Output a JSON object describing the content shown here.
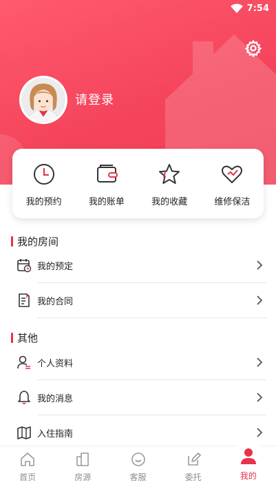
{
  "status_bar": {
    "time": "7:54"
  },
  "profile": {
    "login_text": "请登录"
  },
  "quick_actions": [
    {
      "label": "我的预约",
      "icon": "clock-icon"
    },
    {
      "label": "我的账单",
      "icon": "wallet-icon"
    },
    {
      "label": "我的收藏",
      "icon": "star-icon"
    },
    {
      "label": "维修保洁",
      "icon": "heart-icon"
    }
  ],
  "sections": [
    {
      "title": "我的房间",
      "items": [
        {
          "label": "我的预定",
          "icon": "calendar-icon"
        },
        {
          "label": "我的合同",
          "icon": "contract-icon"
        }
      ]
    },
    {
      "title": "其他",
      "items": [
        {
          "label": "个人资料",
          "icon": "user-icon"
        },
        {
          "label": "我的消息",
          "icon": "bell-icon"
        },
        {
          "label": "入住指南",
          "icon": "map-icon"
        }
      ]
    }
  ],
  "tabbar": [
    {
      "label": "首页",
      "icon": "home-icon",
      "active": false
    },
    {
      "label": "房源",
      "icon": "building-icon",
      "active": false
    },
    {
      "label": "客服",
      "icon": "service-icon",
      "active": false
    },
    {
      "label": "委托",
      "icon": "edit-icon",
      "active": false
    },
    {
      "label": "我的",
      "icon": "profile-icon",
      "active": true
    }
  ],
  "colors": {
    "accent": "#e8324a",
    "header": "#f5455c"
  }
}
